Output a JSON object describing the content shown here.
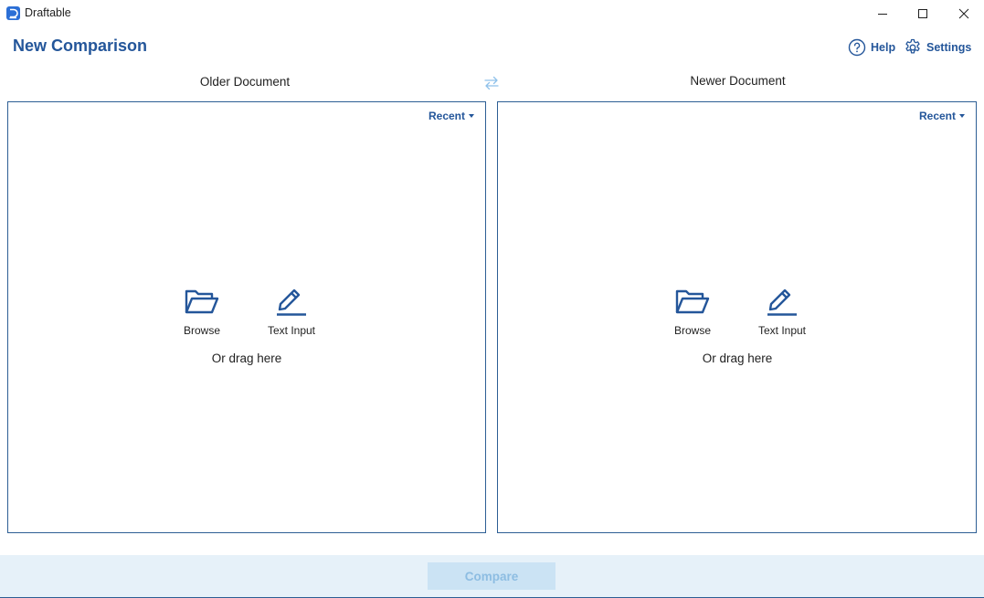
{
  "window": {
    "app_title": "Draftable",
    "icons": {
      "logo": "draftable-logo-icon",
      "minimize": "minimize-icon",
      "maximize": "maximize-icon",
      "close": "close-icon"
    }
  },
  "header": {
    "title": "New Comparison",
    "help_label": "Help",
    "settings_label": "Settings"
  },
  "older": {
    "label": "Older Document",
    "recent_label": "Recent",
    "browse_label": "Browse",
    "text_input_label": "Text Input",
    "drag_hint": "Or drag here"
  },
  "newer": {
    "label": "Newer Document",
    "recent_label": "Recent",
    "browse_label": "Browse",
    "text_input_label": "Text Input",
    "drag_hint": "Or drag here"
  },
  "footer": {
    "compare_label": "Compare"
  },
  "colors": {
    "accent": "#24569a",
    "border": "#2d5e94",
    "footer_bg": "#e6f1f9",
    "compare_disabled_bg": "#cbe3f4",
    "compare_disabled_text": "#8dbde2",
    "swap_icon": "#8fc1ea"
  }
}
